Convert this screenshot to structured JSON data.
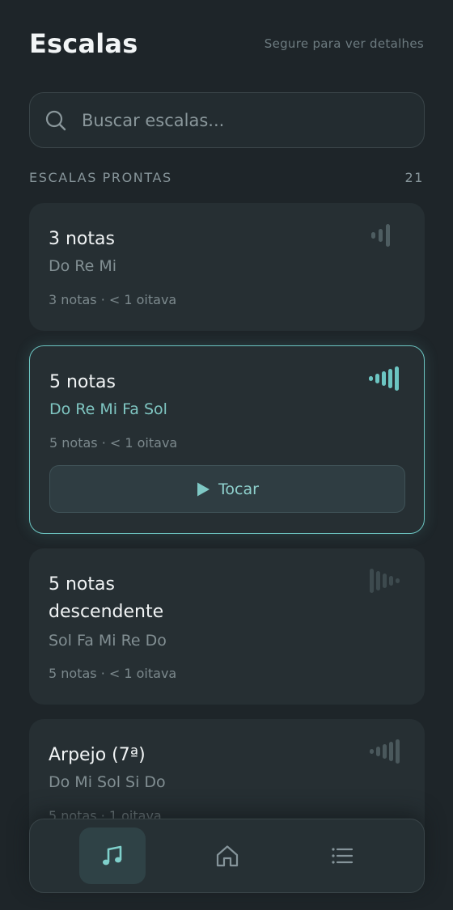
{
  "header": {
    "title": "Escalas",
    "hint": "Segure para ver detalhes"
  },
  "search": {
    "placeholder": "Buscar escalas...",
    "value": "",
    "icon": "search-icon"
  },
  "section": {
    "label": "ESCALAS PRONTAS",
    "count": "21"
  },
  "scales": [
    {
      "name": "3 notas",
      "notes": "Do Re Mi",
      "meta": "3 notas · < 1 oitava",
      "selected": false,
      "icon": "ascending-wave-icon"
    },
    {
      "name": "5 notas",
      "notes": "Do Re Mi Fa Sol",
      "meta": "5 notas · < 1 oitava",
      "selected": true,
      "icon": "ascending-wave-icon"
    },
    {
      "name": "5 notas descendente",
      "notes": "Sol Fa Mi Re Do",
      "meta": "5 notas · < 1 oitava",
      "selected": false,
      "icon": "descending-wave-icon"
    },
    {
      "name": "Arpejo (7ª)",
      "notes": "Do Mi Sol Si Do",
      "meta": "5 notas · 1 oitava",
      "selected": false,
      "icon": "ascending-wave-icon"
    }
  ],
  "play_button": {
    "label": "Tocar",
    "icon": "play-icon"
  },
  "nav": {
    "items": [
      {
        "icon": "music-note-icon",
        "active": true
      },
      {
        "icon": "home-icon",
        "active": false
      },
      {
        "icon": "list-icon",
        "active": false
      }
    ]
  },
  "colors": {
    "background": "#1e2529",
    "card": "#262f33",
    "accent": "#6cc5c2",
    "muted_text": "#828f93"
  }
}
